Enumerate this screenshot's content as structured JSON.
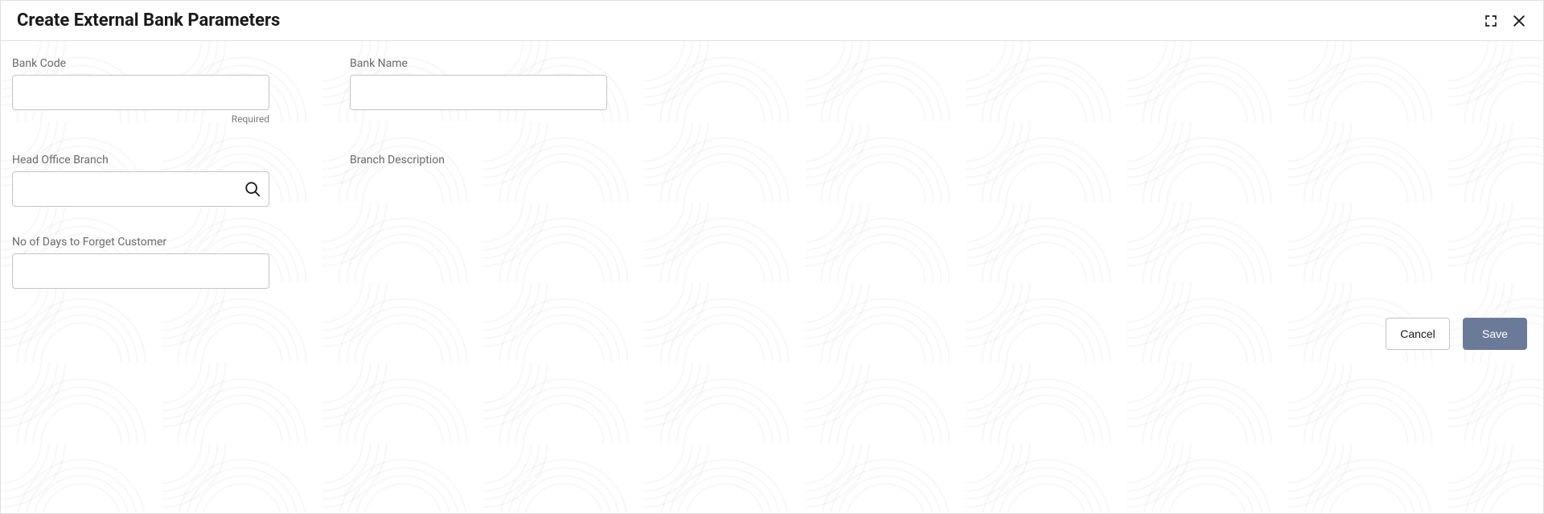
{
  "header": {
    "title": "Create External Bank Parameters"
  },
  "form": {
    "bank_code": {
      "label": "Bank Code",
      "value": "",
      "helper": "Required"
    },
    "bank_name": {
      "label": "Bank Name",
      "value": ""
    },
    "head_office_branch": {
      "label": "Head Office Branch",
      "value": ""
    },
    "branch_description": {
      "label": "Branch Description"
    },
    "days_forget_customer": {
      "label": "No of Days to Forget Customer",
      "value": ""
    }
  },
  "actions": {
    "cancel": "Cancel",
    "save": "Save"
  }
}
